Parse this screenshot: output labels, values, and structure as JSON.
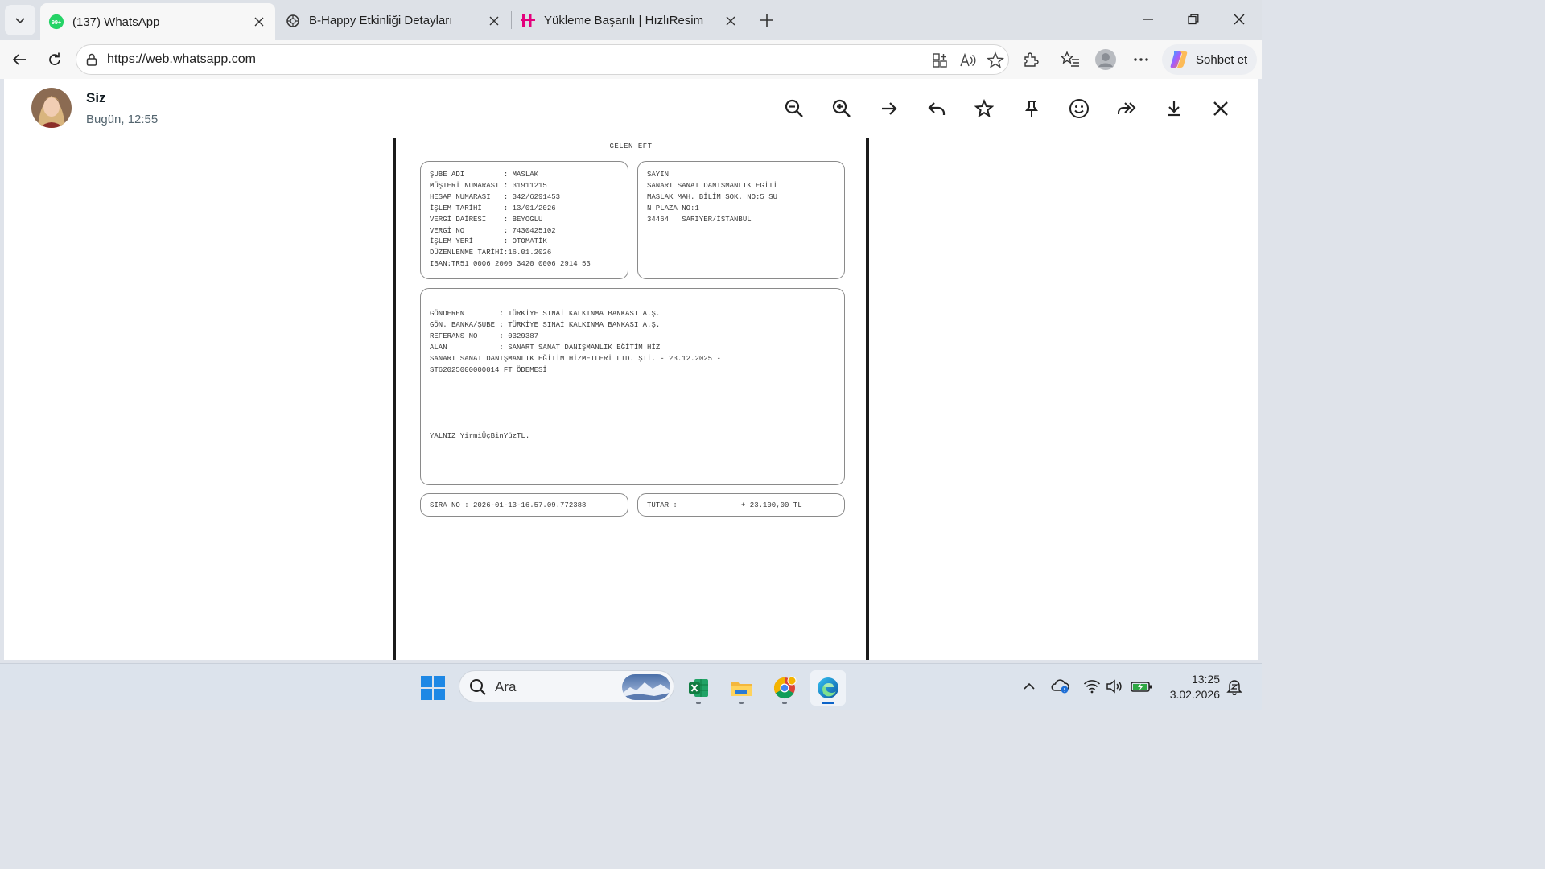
{
  "browser": {
    "tabs": [
      {
        "title": "(137) WhatsApp",
        "badge": "99+",
        "active": true
      },
      {
        "title": "B-Happy Etkinliği Detayları",
        "active": false
      },
      {
        "title": "Yükleme Başarılı | HızlıResim",
        "active": false
      }
    ],
    "url": "https://web.whatsapp.com",
    "copilot_label": "Sohbet et"
  },
  "viewer": {
    "sender_name": "Siz",
    "timestamp": "Bugün, 12:55",
    "toolbar_icons": [
      "zoom-out-icon",
      "zoom-in-icon",
      "forward-arrow-icon",
      "reply-icon",
      "star-icon",
      "pin-icon",
      "emoji-icon",
      "share-icon",
      "download-icon",
      "close-icon"
    ]
  },
  "document": {
    "title": "GELEN EFT",
    "account_box": [
      "ŞUBE ADI         : MASLAK",
      "MÜŞTERİ NUMARASI : 31911215",
      "HESAP NUMARASI   : 342/6291453",
      "İŞLEM TARİHİ     : 13/01/2026",
      "VERGİ DAİRESİ    : BEYOGLU",
      "VERGİ NO         : 7430425102",
      "İŞLEM YERİ       : OTOMATİK",
      "DÜZENLENME TARİHİ:16.01.2026",
      "IBAN:TR51 0006 2000 3420 0006 2914 53"
    ],
    "recipient_box": [
      "SAYIN",
      "SANART SANAT DANISMANLIK EGİTİ",
      "MASLAK MAH. BİLİM SOK. NO:5 SU",
      "N PLAZA NO:1",
      "",
      "34464   SARIYER/İSTANBUL"
    ],
    "details_box": [
      "GÖNDEREN        : TÜRKİYE SINAİ KALKINMA BANKASI A.Ş.",
      "GÖN. BANKA/ŞUBE : TÜRKİYE SINAİ KALKINMA BANKASI A.Ş.",
      "REFERANS NO     : 0329387",
      "ALAN            : SANART SANAT DANIŞMANLIK EĞİTİM HİZ",
      "SANART SANAT DANIŞMANLIK EĞİTİM HİZMETLERİ LTD. ŞTİ. - 23.12.2025 -",
      "ST62025000000014 FT ÖDEMESİ"
    ],
    "amount_words": "YALNIZ YirmiÜçBinYüzTL.",
    "sequence_no": "SIRA NO : 2026-01-13-16.57.09.772388",
    "amount_label": "TUTAR :",
    "amount_value": "+ 23.100,00 TL"
  },
  "taskbar": {
    "search_placeholder": "Ara",
    "apps": [
      "excel-app",
      "file-explorer-app",
      "chrome-app",
      "edge-app"
    ],
    "time": "13:25",
    "date": "3.02.2026"
  }
}
